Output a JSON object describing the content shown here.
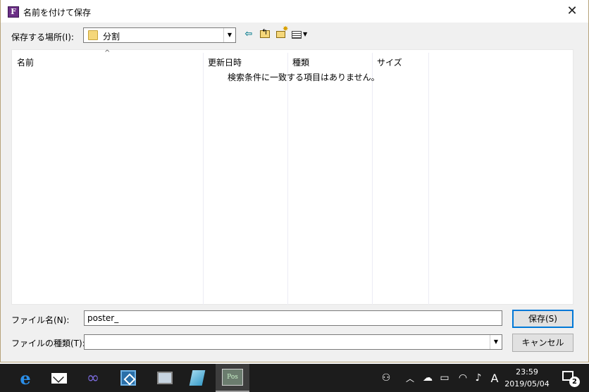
{
  "dialog": {
    "title": "名前を付けて保存",
    "close_glyph": "✕",
    "app_icon_letter": "F"
  },
  "location": {
    "label": "保存する場所(I):",
    "value": "分割"
  },
  "toolbar": {
    "back_icon": "back-arrow-icon",
    "up_icon": "up-folder-icon",
    "new_folder_icon": "new-folder-icon",
    "view_menu_icon": "view-menu-icon"
  },
  "filelist": {
    "columns": [
      "名前",
      "更新日時",
      "種類",
      "サイズ"
    ],
    "empty_message": "検索条件に一致する項目はありません。"
  },
  "filename": {
    "label": "ファイル名(N):",
    "value": "poster_"
  },
  "filetype": {
    "label": "ファイルの種類(T):",
    "value": ""
  },
  "buttons": {
    "save": "保存(S)",
    "cancel": "キャンセル"
  },
  "taskbar": {
    "active_app_label": "Pos",
    "ime": "A",
    "time": "23:59",
    "date": "2019/05/04",
    "notification_count": "2"
  },
  "colors": {
    "accent": "#0078d7",
    "taskbar": "#1c1c1c",
    "dialog_bg": "#f0f0f0"
  }
}
